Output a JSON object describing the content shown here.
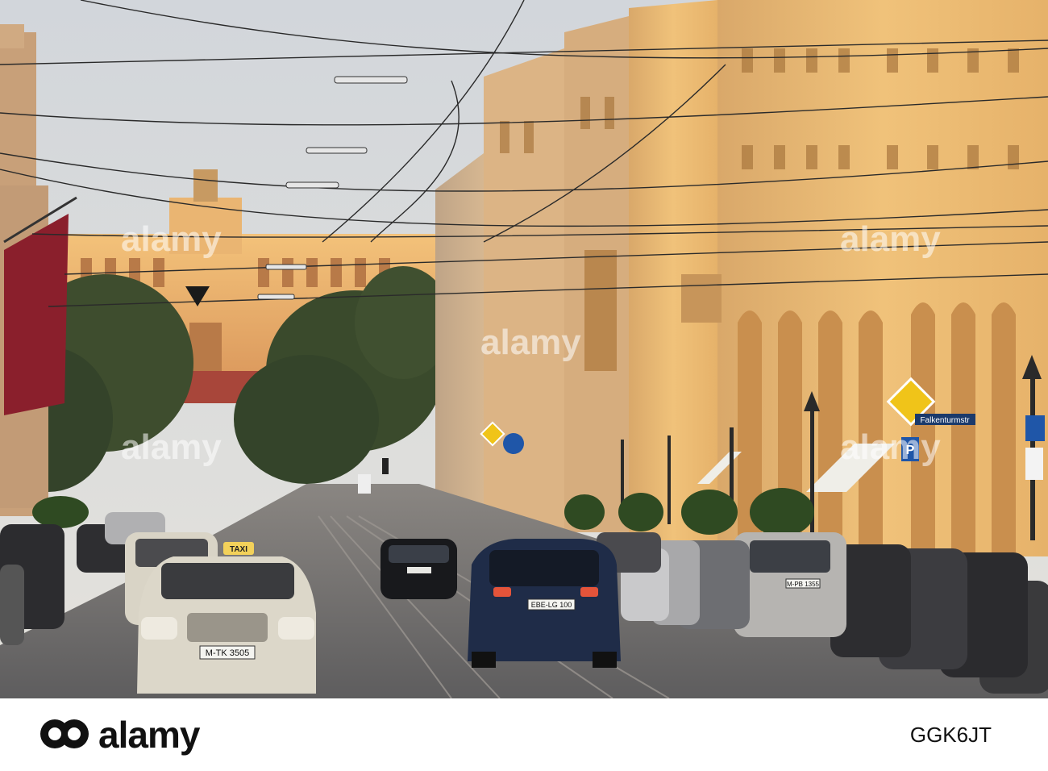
{
  "photo": {
    "street_sign": "Falkenturmstr",
    "taxi_plate": "M-TK 3505",
    "vw_plate": "EBE-LG 100",
    "silver_car_plate": "M-PB 1355",
    "taxi_roof_sign": "TAXI",
    "parking_sign": "P",
    "colors": {
      "sky": "#d9dde2",
      "facade_lit": "#e8b565",
      "facade_shade": "#c9a27a",
      "road": "#6f6d6d",
      "trees": "#3b4a2c",
      "banner": "#8a1f2c"
    }
  },
  "watermark": {
    "text": "alamy"
  },
  "footer": {
    "logo_text": "alamy",
    "image_id": "GGK6JT"
  }
}
